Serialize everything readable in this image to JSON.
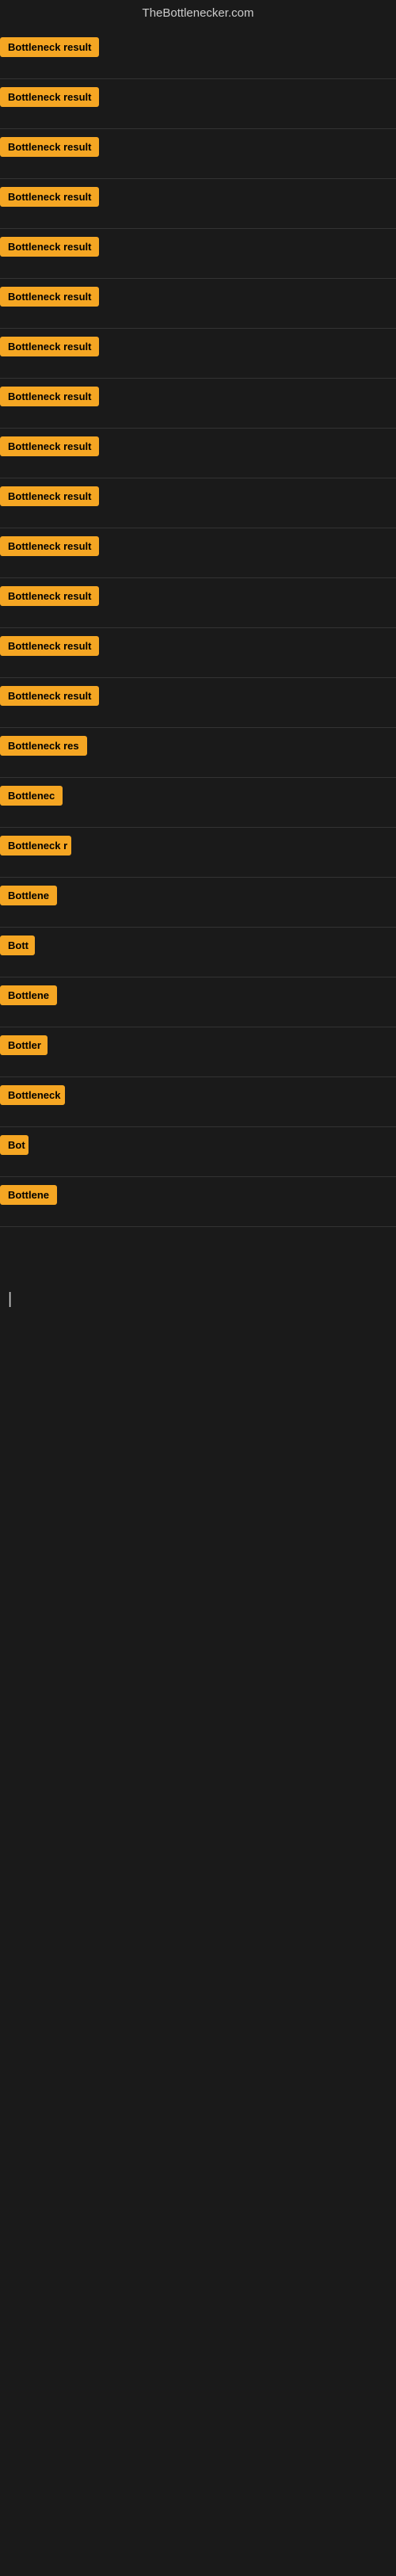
{
  "header": {
    "title": "TheBottlenecker.com"
  },
  "items": [
    {
      "id": 1,
      "label": "Bottleneck result",
      "width": 130
    },
    {
      "id": 2,
      "label": "Bottleneck result",
      "width": 130
    },
    {
      "id": 3,
      "label": "Bottleneck result",
      "width": 130
    },
    {
      "id": 4,
      "label": "Bottleneck result",
      "width": 130
    },
    {
      "id": 5,
      "label": "Bottleneck result",
      "width": 130
    },
    {
      "id": 6,
      "label": "Bottleneck result",
      "width": 130
    },
    {
      "id": 7,
      "label": "Bottleneck result",
      "width": 130
    },
    {
      "id": 8,
      "label": "Bottleneck result",
      "width": 130
    },
    {
      "id": 9,
      "label": "Bottleneck result",
      "width": 130
    },
    {
      "id": 10,
      "label": "Bottleneck result",
      "width": 130
    },
    {
      "id": 11,
      "label": "Bottleneck result",
      "width": 130
    },
    {
      "id": 12,
      "label": "Bottleneck result",
      "width": 130
    },
    {
      "id": 13,
      "label": "Bottleneck result",
      "width": 130
    },
    {
      "id": 14,
      "label": "Bottleneck result",
      "width": 130
    },
    {
      "id": 15,
      "label": "Bottleneck res",
      "width": 115
    },
    {
      "id": 16,
      "label": "Bottlenec",
      "width": 80
    },
    {
      "id": 17,
      "label": "Bottleneck r",
      "width": 90
    },
    {
      "id": 18,
      "label": "Bottlene",
      "width": 72
    },
    {
      "id": 19,
      "label": "Bott",
      "width": 44
    },
    {
      "id": 20,
      "label": "Bottlene",
      "width": 72
    },
    {
      "id": 21,
      "label": "Bottler",
      "width": 60
    },
    {
      "id": 22,
      "label": "Bottleneck",
      "width": 82
    },
    {
      "id": 23,
      "label": "Bot",
      "width": 36
    },
    {
      "id": 24,
      "label": "Bottlene",
      "width": 72
    }
  ],
  "cursor": "|"
}
